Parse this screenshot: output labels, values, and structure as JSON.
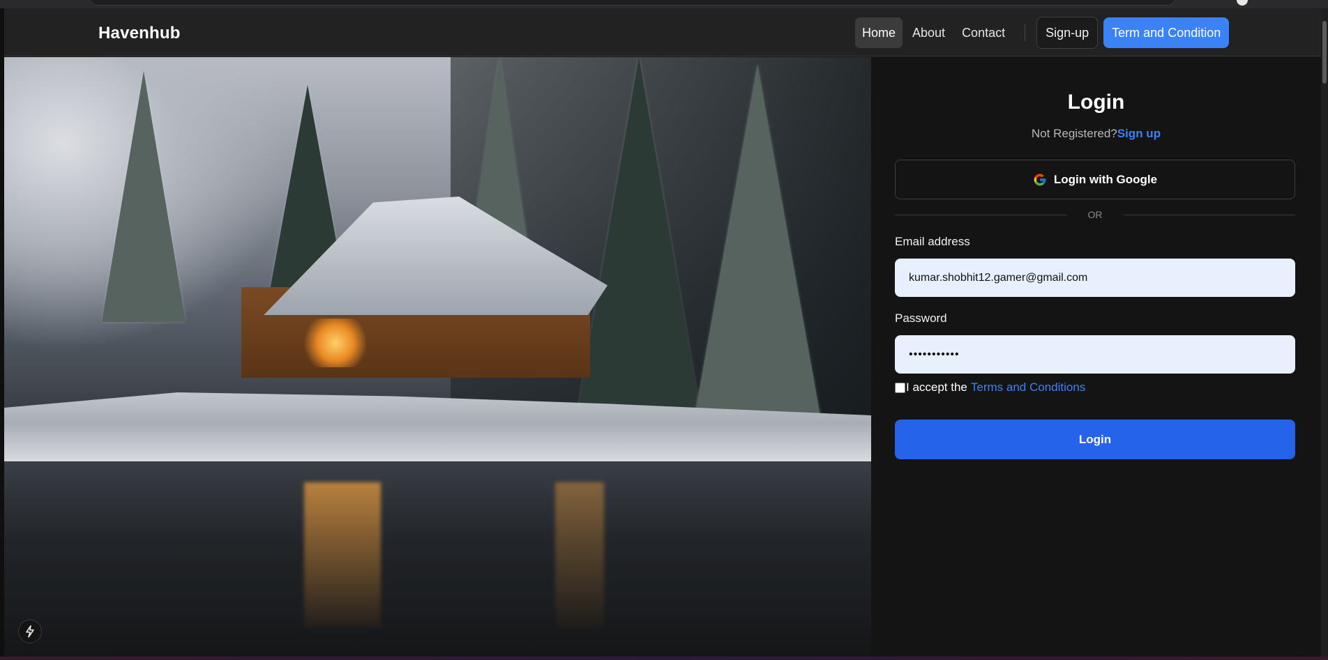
{
  "navbar": {
    "brand": "Havenhub",
    "links": [
      {
        "label": "Home",
        "active": true
      },
      {
        "label": "About",
        "active": false
      },
      {
        "label": "Contact",
        "active": false
      }
    ],
    "signup_label": "Sign-up",
    "terms_label": "Term and Condition"
  },
  "hero": {
    "image_subject": "Snow-covered wooden cabin by a lake surrounded by pine trees",
    "badge_icon": "lightning-bolt-icon"
  },
  "login": {
    "title": "Login",
    "not_registered": "Not Registered?",
    "signup_link": "Sign up",
    "google_button": "Login with Google",
    "google_icon": "google-g-icon",
    "divider": "OR",
    "email_label": "Email address",
    "email_value": "kumar.shobhit12.gamer@gmail.com",
    "password_label": "Password",
    "password_value": "•••••••••••",
    "terms_prefix": "I accept the",
    "terms_link": "Terms and Conditions",
    "terms_checked": false,
    "submit": "Login"
  },
  "colors": {
    "accent": "#3b82f6",
    "primary_button": "#2563eb",
    "navbar_bg": "#222222",
    "panel_bg": "#141414",
    "input_bg": "#e8f0fe"
  }
}
